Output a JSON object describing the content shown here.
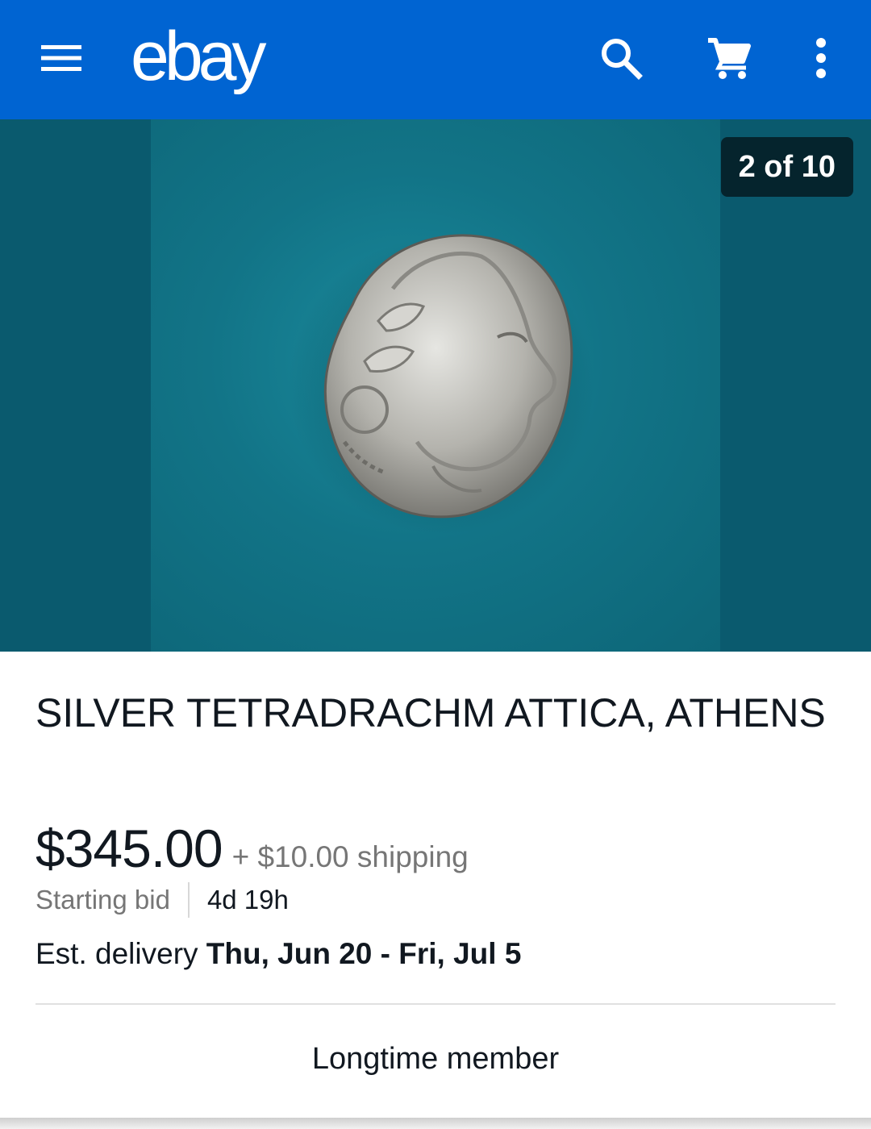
{
  "appbar": {
    "logo": "ebay",
    "icons": {
      "menu": "menu-icon",
      "search": "search-icon",
      "cart": "cart-icon",
      "overflow": "more-vert-icon"
    },
    "background_color": "#0064d2"
  },
  "gallery": {
    "counter": "2 of 10",
    "image": "silver-coin-photo"
  },
  "listing": {
    "title": "SILVER TETRADRACHM ATTICA, ATHENS",
    "price": "$345.00",
    "shipping": "+ $10.00 shipping",
    "bid_label": "Starting bid",
    "time_left": "4d 19h",
    "delivery_label": "Est. delivery",
    "delivery_dates": "Thu, Jun 20 - Fri, Jul 5",
    "seller_badge": "Longtime member"
  }
}
